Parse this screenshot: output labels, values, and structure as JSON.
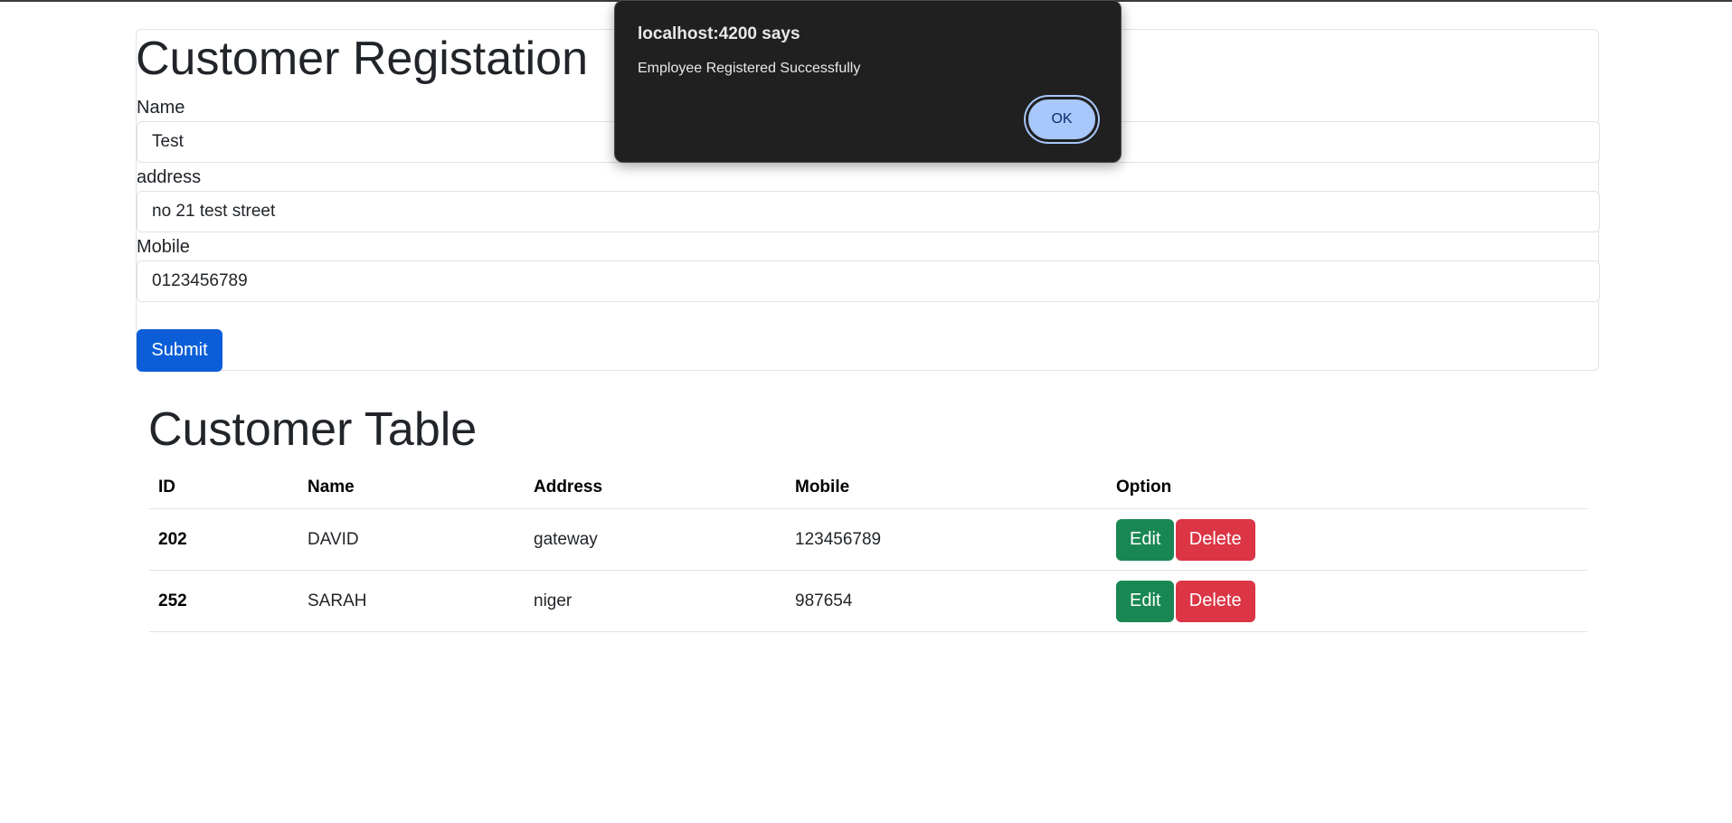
{
  "registration": {
    "title": "Customer Registation",
    "name_label": "Name",
    "name_value": "Test",
    "address_label": "address",
    "address_value": "no 21 test street",
    "mobile_label": "Mobile",
    "mobile_value": "0123456789",
    "submit_label": "Submit"
  },
  "table": {
    "title": "Customer Table",
    "headers": [
      "ID",
      "Name",
      "Address",
      "Mobile",
      "Option"
    ],
    "rows": [
      {
        "id": "202",
        "name": "DAVID",
        "address": "gateway",
        "mobile": "123456789",
        "edit": "Edit",
        "delete": "Delete"
      },
      {
        "id": "252",
        "name": "SARAH",
        "address": "niger",
        "mobile": "987654",
        "edit": "Edit",
        "delete": "Delete"
      }
    ]
  },
  "dialog": {
    "title": "localhost:4200 says",
    "message": "Employee Registered Successfully",
    "ok_label": "OK"
  },
  "colors": {
    "primary": "#0b5ed7",
    "success": "#198754",
    "danger": "#dc3545",
    "dialog_bg": "#202020",
    "dialog_button": "#a8c7fa"
  }
}
